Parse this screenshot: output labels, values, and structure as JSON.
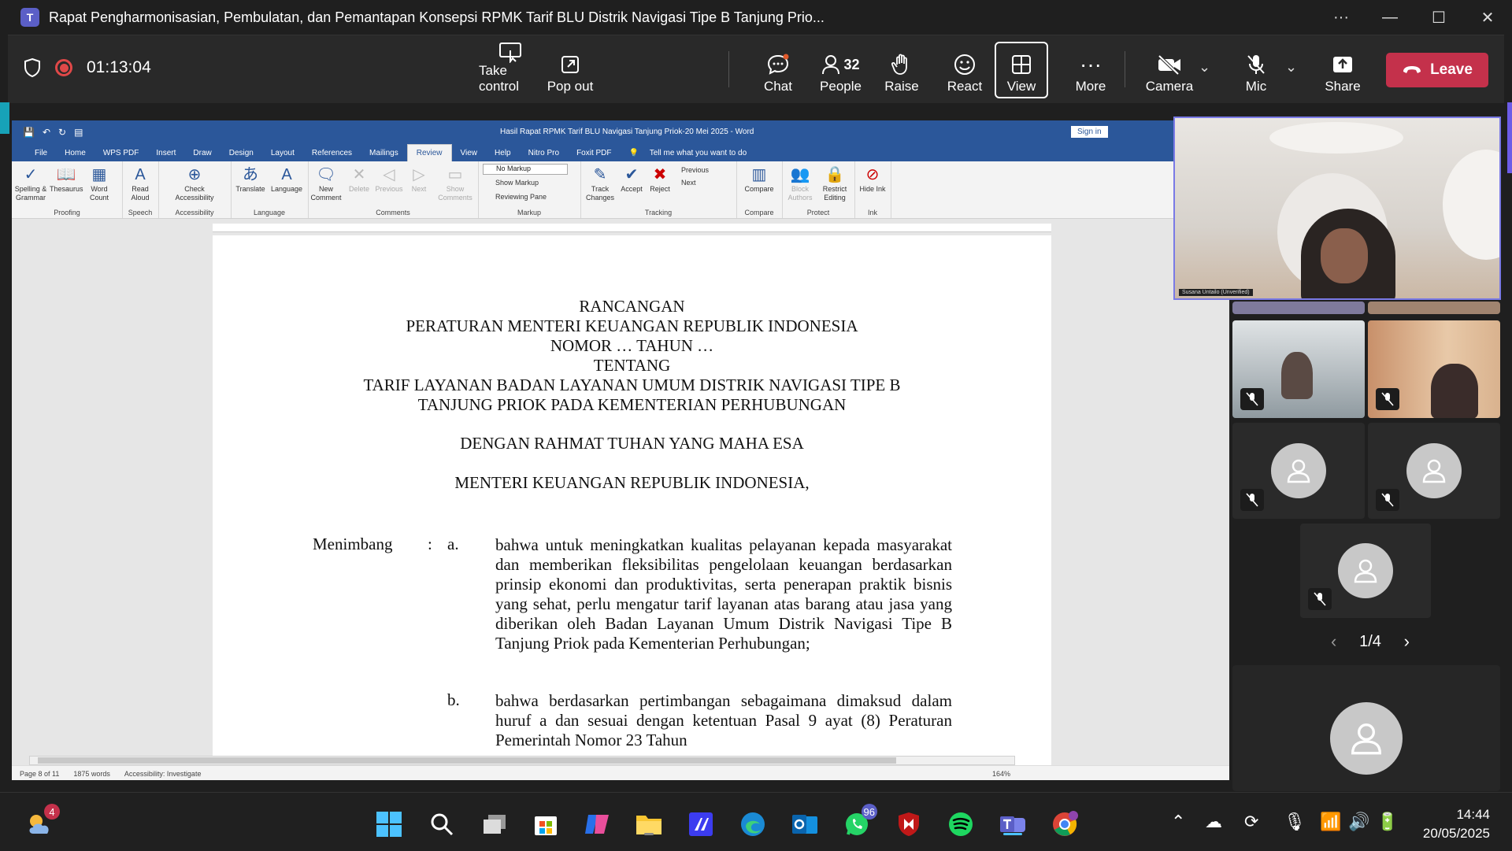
{
  "window": {
    "title": "Rapat Pengharmonisasian, Pembulatan, dan Pemantapan Konsepsi RPMK Tarif BLU Distrik Navigasi Tipe B Tanjung Prio...",
    "more": "···",
    "minimize": "—",
    "maximize": "☐",
    "close": "✕"
  },
  "meeting": {
    "timer": "01:13:04",
    "buttons": {
      "take_control": "Take control",
      "pop_out": "Pop out",
      "chat": "Chat",
      "people": "People",
      "people_count": "32",
      "raise": "Raise",
      "react": "React",
      "view": "View",
      "more": "More",
      "camera": "Camera",
      "mic": "Mic",
      "share": "Share",
      "leave": "Leave"
    },
    "colors": {
      "leave": "#c4314b",
      "recording": "#e04848",
      "accent": "#5b5fc7"
    }
  },
  "word": {
    "doc_title": "Hasil Rapat RPMK Tarif BLU Navigasi Tanjung Priok-20 Mei 2025 - Word",
    "sign_in": "Sign in",
    "menu": [
      "File",
      "Home",
      "WPS PDF",
      "Insert",
      "Draw",
      "Design",
      "Layout",
      "References",
      "Mailings",
      "Review",
      "View",
      "Help",
      "Nitro Pro",
      "Foxit PDF"
    ],
    "active_tab": "Review",
    "tell_me": "Tell me what you want to do",
    "ribbon": {
      "spelling": "Spelling & Grammar",
      "thesaurus": "Thesaurus",
      "word_count": "Word Count",
      "read_aloud": "Read Aloud",
      "check_accessibility": "Check Accessibility",
      "translate": "Translate",
      "language": "Language",
      "new_comment": "New Comment",
      "delete": "Delete",
      "previous": "Previous",
      "next": "Next",
      "show_comments": "Show Comments",
      "markup_select": "No Markup",
      "show_markup": "Show Markup",
      "reviewing_pane": "Reviewing Pane",
      "track_changes": "Track Changes",
      "accept": "Accept",
      "reject": "Reject",
      "prev_change": "Previous",
      "next_change": "Next",
      "compare": "Compare",
      "block_authors": "Block Authors",
      "restrict_editing": "Restrict Editing",
      "hide_ink": "Hide Ink",
      "groups": {
        "proofing": "Proofing",
        "speech": "Speech",
        "accessibility": "Accessibility",
        "language": "Language",
        "comments": "Comments",
        "markup": "Markup",
        "tracking": "Tracking",
        "compare": "Compare",
        "protect": "Protect",
        "ink": "Ink"
      }
    },
    "document": {
      "line1": "RANCANGAN",
      "line2": "PERATURAN MENTERI KEUANGAN REPUBLIK INDONESIA",
      "line3": "NOMOR  … TAHUN …",
      "line4": "TENTANG",
      "line5": "TARIF LAYANAN BADAN LAYANAN UMUM DISTRIK NAVIGASI TIPE B",
      "line6": "TANJUNG PRIOK PADA KEMENTERIAN PERHUBUNGAN",
      "line7": "DENGAN RAHMAT TUHAN YANG MAHA ESA",
      "line8": "MENTERI KEUANGAN REPUBLIK INDONESIA,",
      "menimbang": "Menimbang",
      "colon": ":",
      "marker_a": "a.",
      "para_a": "bahwa untuk meningkatkan kualitas pelayanan kepada masyarakat dan memberikan fleksibilitas pengelolaan keuangan berdasarkan prinsip ekonomi dan produktivitas, serta penerapan praktik bisnis yang sehat, perlu mengatur tarif layanan atas barang atau jasa yang diberikan oleh Badan Layanan Umum Distrik Navigasi Tipe B Tanjung Priok pada Kementerian Perhubungan;",
      "marker_b": "b.",
      "para_b": "bahwa berdasarkan pertimbangan sebagaimana dimaksud dalam huruf a dan sesuai dengan ketentuan Pasal 9 ayat (8) Peraturan Pemerintah Nomor 23 Tahun"
    },
    "status": {
      "page": "Page 8 of 11",
      "words": "1875 words",
      "accessibility": "Accessibility: Investigate",
      "zoom": "164%"
    }
  },
  "participants": {
    "self_name": "Susana Untailo (Unverified)",
    "pager": "1/4"
  },
  "taskbar": {
    "weather_badge": "4",
    "whatsapp_badge": "96",
    "time": "14:44",
    "date": "20/05/2025"
  }
}
